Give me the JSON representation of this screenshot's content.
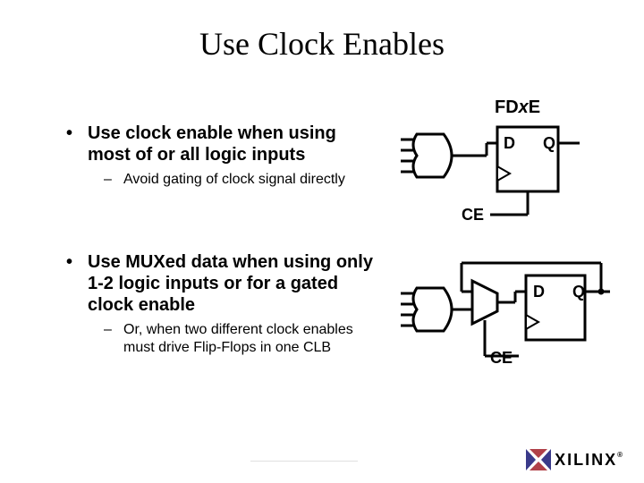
{
  "title": "Use Clock Enables",
  "bullets": {
    "b1_line1": "Use clock enable when using",
    "b1_line2": "most of or all logic inputs",
    "b1_sub": "Avoid gating of clock signal directly",
    "b2_line1": "Use MUXed data when using only",
    "b2_line2": "1-2 logic inputs or for a gated",
    "b2_line3": "clock enable",
    "b2_sub_line1": "Or, when two different clock enables",
    "b2_sub_line2": "must drive Flip-Flops in one CLB"
  },
  "labels": {
    "fdxe_pre": "FD",
    "fdxe_x": "x",
    "fdxe_post": "E",
    "D": "D",
    "Q": "Q",
    "CE": "CE"
  },
  "logo": {
    "brand": "XILINX",
    "reg": "®"
  }
}
